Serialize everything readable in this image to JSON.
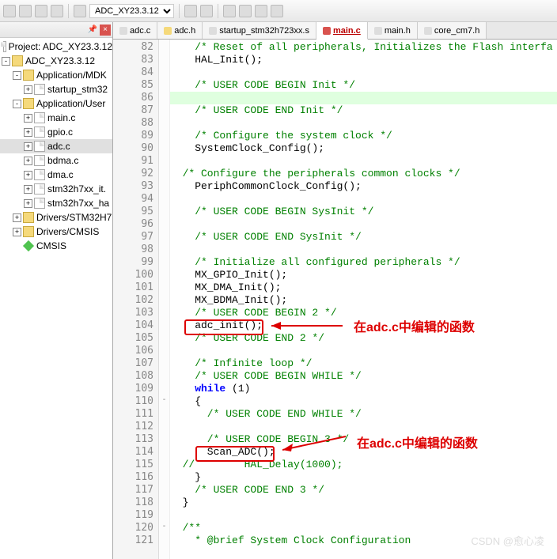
{
  "toolbar": {
    "combo": "ADC_XY23.3.12"
  },
  "sidebar": {
    "title": "Project: ADC_XY23.3.12",
    "root": "ADC_XY23.3.12",
    "groups": [
      {
        "label": "Application/MDK",
        "expanded": true,
        "items": [
          {
            "label": "startup_stm32"
          }
        ]
      },
      {
        "label": "Application/User",
        "expanded": true,
        "items": [
          {
            "label": "main.c"
          },
          {
            "label": "gpio.c"
          },
          {
            "label": "adc.c",
            "selected": true
          },
          {
            "label": "bdma.c"
          },
          {
            "label": "dma.c"
          },
          {
            "label": "stm32h7xx_it."
          },
          {
            "label": "stm32h7xx_ha"
          }
        ]
      },
      {
        "label": "Drivers/STM32H7",
        "expanded": false,
        "items": []
      },
      {
        "label": "Drivers/CMSIS",
        "expanded": false,
        "items": []
      }
    ],
    "extra": {
      "label": "CMSIS"
    }
  },
  "tabs": [
    {
      "label": "adc.c",
      "color": "grey"
    },
    {
      "label": "adc.h",
      "color": "yellow"
    },
    {
      "label": "startup_stm32h723xx.s",
      "color": "grey"
    },
    {
      "label": "main.c",
      "color": "red",
      "active": true
    },
    {
      "label": "main.h",
      "color": "grey"
    },
    {
      "label": "core_cm7.h",
      "color": "grey"
    }
  ],
  "code": {
    "start": 82,
    "lines": [
      {
        "n": 82,
        "t": "    /* Reset of all peripherals, Initializes the Flash interfa",
        "cls": "c-comment"
      },
      {
        "n": 83,
        "t": "    HAL_Init();"
      },
      {
        "n": 84,
        "t": ""
      },
      {
        "n": 85,
        "t": "    /* USER CODE BEGIN Init */",
        "cls": "c-comment"
      },
      {
        "n": 86,
        "t": "",
        "hl": true
      },
      {
        "n": 87,
        "t": "    /* USER CODE END Init */",
        "cls": "c-comment"
      },
      {
        "n": 88,
        "t": ""
      },
      {
        "n": 89,
        "t": "    /* Configure the system clock */",
        "cls": "c-comment"
      },
      {
        "n": 90,
        "t": "    SystemClock_Config();"
      },
      {
        "n": 91,
        "t": ""
      },
      {
        "n": 92,
        "t": "  /* Configure the peripherals common clocks */",
        "cls": "c-comment"
      },
      {
        "n": 93,
        "t": "    PeriphCommonClock_Config();"
      },
      {
        "n": 94,
        "t": ""
      },
      {
        "n": 95,
        "t": "    /* USER CODE BEGIN SysInit */",
        "cls": "c-comment"
      },
      {
        "n": 96,
        "t": ""
      },
      {
        "n": 97,
        "t": "    /* USER CODE END SysInit */",
        "cls": "c-comment"
      },
      {
        "n": 98,
        "t": ""
      },
      {
        "n": 99,
        "t": "    /* Initialize all configured peripherals */",
        "cls": "c-comment"
      },
      {
        "n": 100,
        "t": "    MX_GPIO_Init();"
      },
      {
        "n": 101,
        "t": "    MX_DMA_Init();"
      },
      {
        "n": 102,
        "t": "    MX_BDMA_Init();"
      },
      {
        "n": 103,
        "t": "    /* USER CODE BEGIN 2 */",
        "cls": "c-comment"
      },
      {
        "n": 104,
        "t": "    adc_init();"
      },
      {
        "n": 105,
        "t": "    /* USER CODE END 2 */",
        "cls": "c-comment"
      },
      {
        "n": 106,
        "t": ""
      },
      {
        "n": 107,
        "t": "    /* Infinite loop */",
        "cls": "c-comment"
      },
      {
        "n": 108,
        "t": "    /* USER CODE BEGIN WHILE */",
        "cls": "c-comment"
      },
      {
        "n": 109,
        "t": "    while (1)",
        "kw": true
      },
      {
        "n": 110,
        "t": "    {",
        "fold": "-"
      },
      {
        "n": 111,
        "t": "      /* USER CODE END WHILE */",
        "cls": "c-comment"
      },
      {
        "n": 112,
        "t": ""
      },
      {
        "n": 113,
        "t": "      /* USER CODE BEGIN 3 */",
        "cls": "c-comment"
      },
      {
        "n": 114,
        "t": "      Scan_ADC();"
      },
      {
        "n": 115,
        "t": "  //        HAL_Delay(1000);",
        "cls": "c-comment"
      },
      {
        "n": 116,
        "t": "    }"
      },
      {
        "n": 117,
        "t": "    /* USER CODE END 3 */",
        "cls": "c-comment"
      },
      {
        "n": 118,
        "t": "  }"
      },
      {
        "n": 119,
        "t": ""
      },
      {
        "n": 120,
        "t": "  /**",
        "cls": "c-comment",
        "fold": "-"
      },
      {
        "n": 121,
        "t": "    * @brief System Clock Configuration",
        "cls": "c-comment"
      }
    ]
  },
  "annotations": {
    "a1": "在adc.c中编辑的函数",
    "a2": "在adc.c中编辑的函数"
  },
  "watermark": "CSDN @愈心凌"
}
